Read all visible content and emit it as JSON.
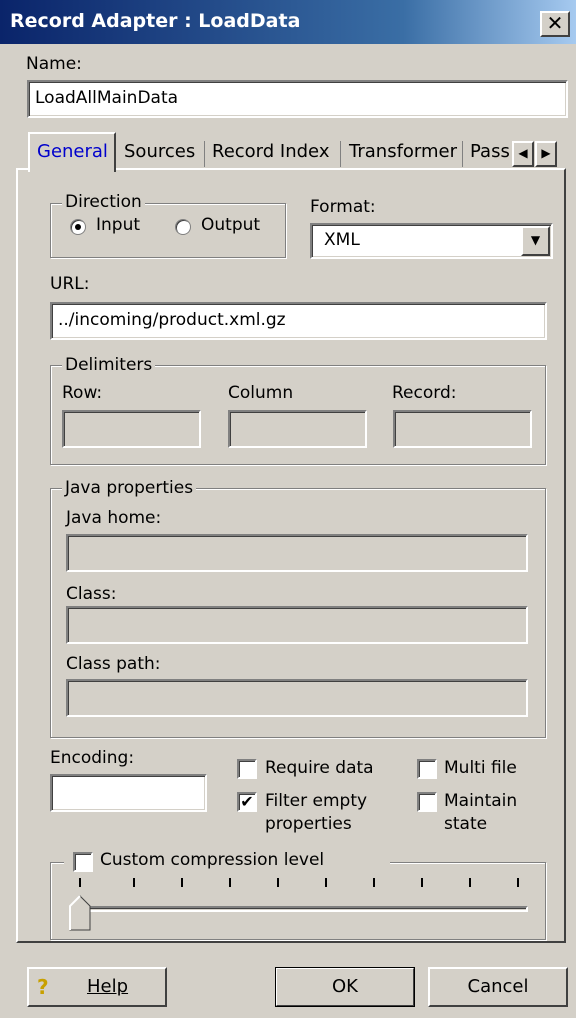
{
  "window": {
    "title": "Record Adapter : LoadData",
    "close_label": "✕"
  },
  "name": {
    "label": "Name:",
    "value": "LoadAllMainData"
  },
  "tabs": [
    "General",
    "Sources",
    "Record Index",
    "Transformer",
    "Pass"
  ],
  "active_tab": "General",
  "direction": {
    "legend": "Direction",
    "input_label": "Input",
    "output_label": "Output",
    "selected": "Input"
  },
  "format": {
    "label": "Format:",
    "value": "XML"
  },
  "url": {
    "label": "URL:",
    "value": "../incoming/product.xml.gz"
  },
  "delimiters": {
    "legend": "Delimiters",
    "row_label": "Row:",
    "column_label": "Column",
    "record_label": "Record:"
  },
  "java": {
    "legend": "Java properties",
    "home_label": "Java home:",
    "class_label": "Class:",
    "classpath_label": "Class path:"
  },
  "encoding": {
    "label": "Encoding:",
    "value": ""
  },
  "checkboxes": {
    "require_data": {
      "label": "Require data",
      "checked": false
    },
    "filter_empty_line1": "Filter empty",
    "filter_empty_line2": "properties",
    "filter_empty_checked": true,
    "multi_file": {
      "label": "Multi file",
      "checked": false
    },
    "maintain_state_line1": "Maintain",
    "maintain_state_line2": "state",
    "maintain_state_checked": false
  },
  "compression": {
    "label": "Custom compression level",
    "checked": false,
    "level": 0
  },
  "buttons": {
    "help": "Help",
    "ok": "OK",
    "cancel": "Cancel"
  },
  "icons": {
    "help": "question-mark-icon",
    "close": "close-x-icon"
  },
  "colors": {
    "titlebar_start": "#0a246a",
    "titlebar_end": "#a6caf0",
    "face": "#d4d0c8",
    "active_tab_text": "#0000cc"
  }
}
